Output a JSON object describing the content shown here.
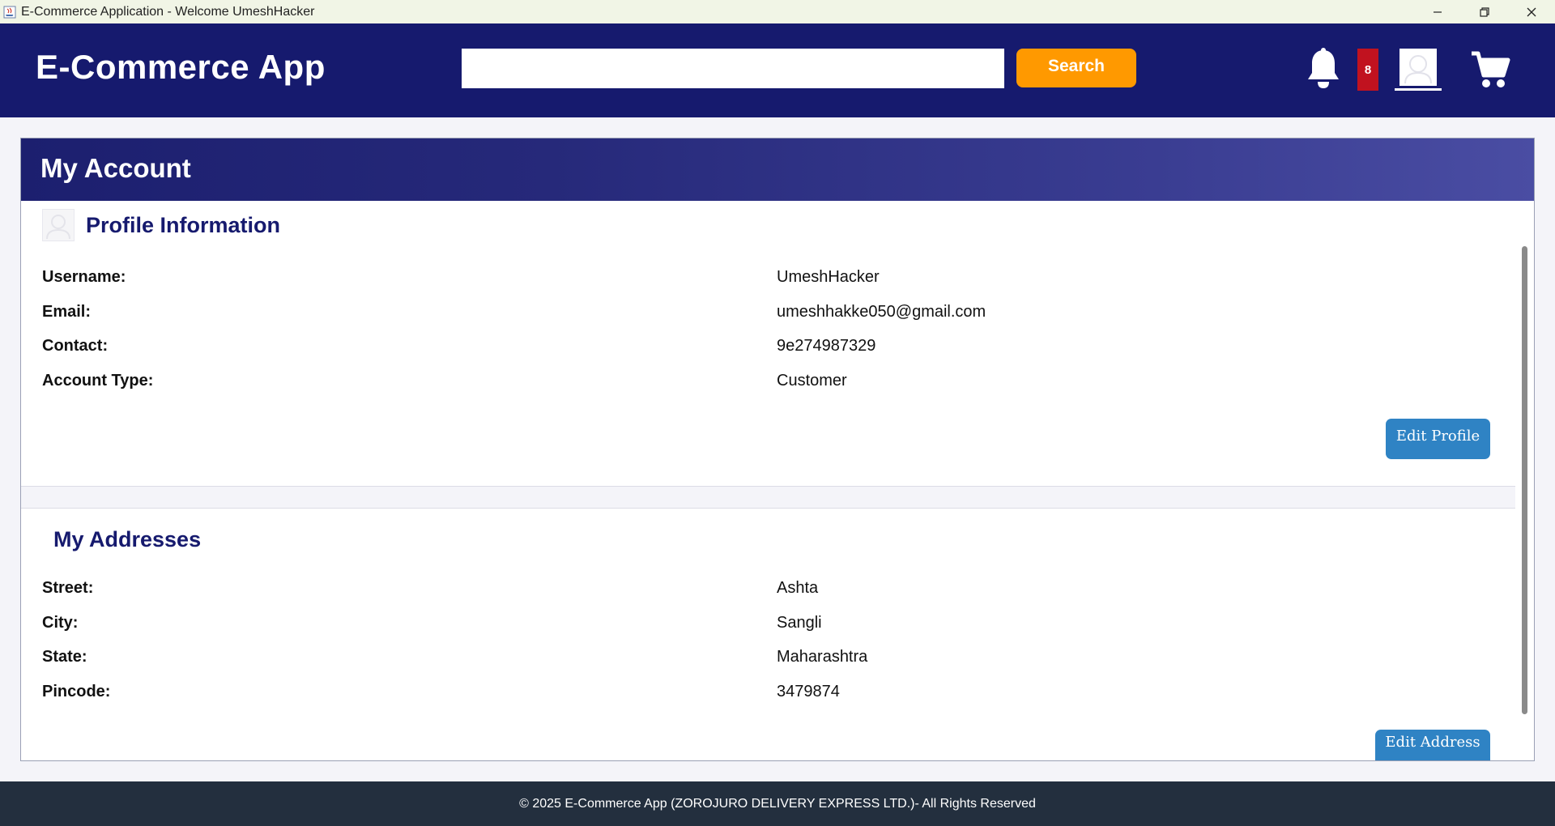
{
  "window": {
    "title": "E-Commerce Application - Welcome UmeshHacker",
    "icons": [
      "java-app-icon",
      "minimize-icon",
      "restore-icon",
      "close-icon"
    ]
  },
  "header": {
    "brand": "E-Commerce App",
    "search": {
      "value": "",
      "placeholder": ""
    },
    "search_button": "Search",
    "notification_count": "8",
    "icons": [
      "bell-icon",
      "user-avatar-icon",
      "cart-icon"
    ],
    "colors": {
      "bar": "#161a6e",
      "search_button": "#ff9900",
      "badge": "#c1121f"
    }
  },
  "account": {
    "title": "My Account",
    "profile": {
      "title": "Profile Information",
      "fields": [
        {
          "label": "Username:",
          "value": "UmeshHacker"
        },
        {
          "label": "Email:",
          "value": "umeshhakke050@gmail.com"
        },
        {
          "label": "Contact:",
          "value": "9e274987329"
        },
        {
          "label": "Account Type:",
          "value": "Customer"
        }
      ],
      "edit_button": "Edit Profile"
    },
    "addresses": {
      "title": "My Addresses",
      "fields": [
        {
          "label": "Street:",
          "value": "Ashta"
        },
        {
          "label": "City:",
          "value": "Sangli"
        },
        {
          "label": "State:",
          "value": "Maharashtra"
        },
        {
          "label": "Pincode:",
          "value": "3479874"
        }
      ],
      "edit_button": "Edit Address"
    },
    "colors": {
      "edit_button": "#2f83c4",
      "section_title": "#161a6e"
    }
  },
  "footer": {
    "text": "© 2025 E-Commerce App (ZOROJURO DELIVERY EXPRESS LTD.)- All Rights Reserved"
  }
}
